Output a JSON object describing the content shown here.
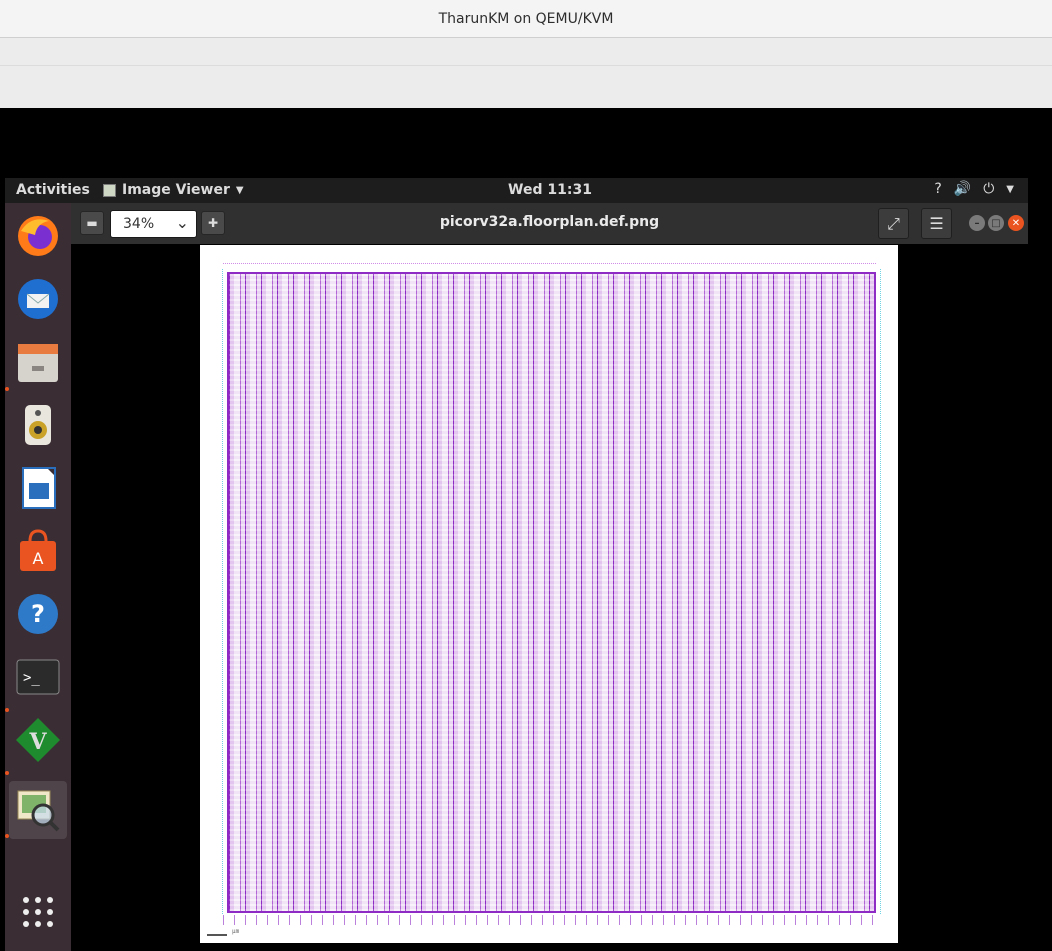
{
  "host": {
    "title": "TharunKM on QEMU/KVM"
  },
  "topbar": {
    "activities": "Activities",
    "app_name": "Image Viewer",
    "clock": "Wed 11:31"
  },
  "dock": {
    "items": [
      {
        "name": "firefox",
        "running": false
      },
      {
        "name": "thunderbird",
        "running": false
      },
      {
        "name": "files",
        "running": true
      },
      {
        "name": "rhythmbox",
        "running": false
      },
      {
        "name": "libreoffice-writer",
        "running": false
      },
      {
        "name": "ubuntu-software",
        "running": false
      },
      {
        "name": "help",
        "running": false
      },
      {
        "name": "terminal",
        "running": true
      },
      {
        "name": "vim",
        "running": true
      },
      {
        "name": "image-viewer",
        "running": true,
        "active": true
      }
    ]
  },
  "viewer": {
    "zoom": "34%",
    "filename": "picorv32a.floorplan.def.png",
    "scale_label": "μm"
  },
  "colors": {
    "accent": "#e95420",
    "plot": "#8e2bc4"
  }
}
